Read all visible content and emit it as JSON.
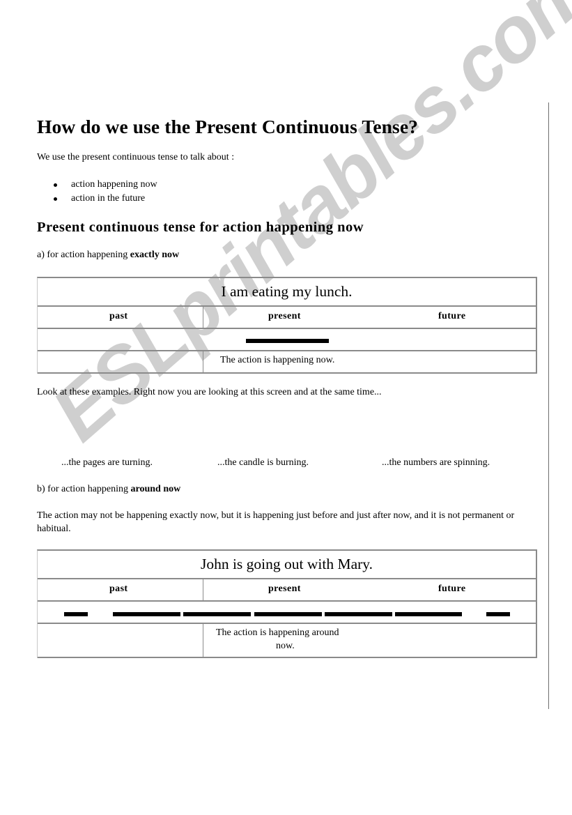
{
  "document": {
    "title": "How do we use the Present Continuous Tense?",
    "intro": "We use the present continuous tense to talk about :",
    "bullets": [
      "action happening now",
      "action in the future"
    ],
    "section_heading": "Present continuous tense for action happening now",
    "part_a": {
      "prefix": "a) for action happening ",
      "bold": "exactly now"
    },
    "table_a": {
      "sentence": "I am eating my lunch.",
      "headers": [
        "past",
        "present",
        "future"
      ],
      "description": "The action is happening now."
    },
    "examples_intro": "Look at these examples. Right now you are looking at this screen and at the same time...",
    "examples": [
      "...the pages are turning.",
      "...the candle is burning.",
      "...the numbers are spinning."
    ],
    "part_b": {
      "prefix": "b) for action happening ",
      "bold": "around now"
    },
    "part_b_paragraph": "The action may not be happening exactly now, but it is happening just before and just after now, and it is not permanent or habitual.",
    "table_b": {
      "sentence": "John is going out with Mary.",
      "headers": [
        "past",
        "present",
        "future"
      ],
      "description_line1": "The action is happening around",
      "description_line2": "now."
    }
  },
  "watermark": "ESLprintables.com"
}
